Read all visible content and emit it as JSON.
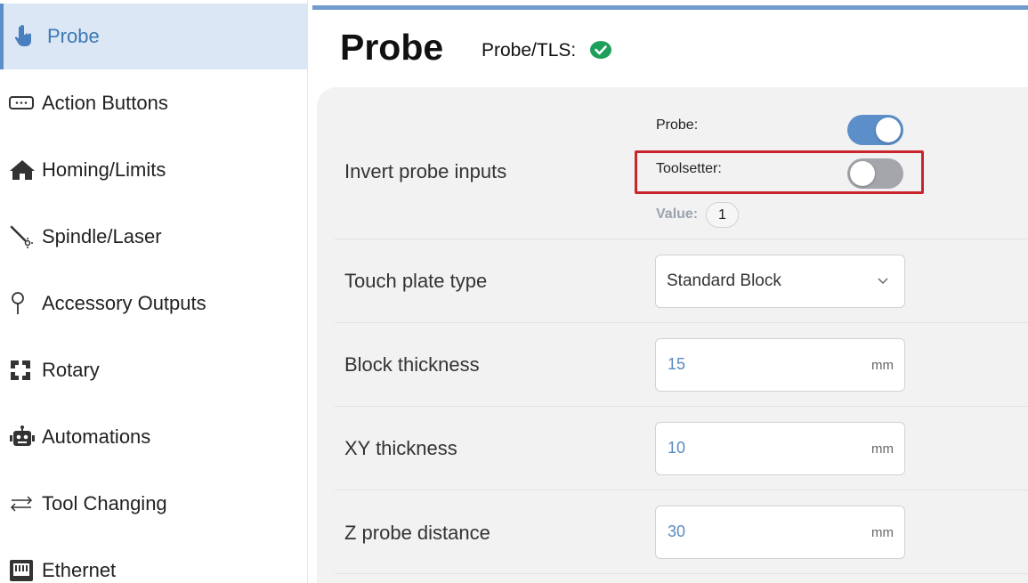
{
  "sidebar": {
    "items": [
      {
        "label": "Probe",
        "icon": "hand-pointer-icon",
        "active": true
      },
      {
        "label": "Action Buttons",
        "icon": "keyboard-icon"
      },
      {
        "label": "Homing/Limits",
        "icon": "home-icon"
      },
      {
        "label": "Spindle/Laser",
        "icon": "spindle-icon"
      },
      {
        "label": "Accessory Outputs",
        "icon": "pin-icon"
      },
      {
        "label": "Rotary",
        "icon": "rotary-icon"
      },
      {
        "label": "Automations",
        "icon": "robot-icon"
      },
      {
        "label": "Tool Changing",
        "icon": "swap-arrows-icon"
      },
      {
        "label": "Ethernet",
        "icon": "ethernet-icon"
      }
    ]
  },
  "header": {
    "title": "Probe",
    "status_label": "Probe/TLS:",
    "status_icon": "check-circle-icon",
    "status_color": "#1e9e5b"
  },
  "settings": {
    "invert": {
      "label": "Invert probe inputs",
      "probe_label": "Probe:",
      "probe_on": true,
      "toolsetter_label": "Toolsetter:",
      "toolsetter_on": false,
      "value_label": "Value:",
      "value": "1"
    },
    "touch_plate": {
      "label": "Touch plate type",
      "selected": "Standard Block"
    },
    "block_thickness": {
      "label": "Block thickness",
      "value": "15",
      "unit": "mm"
    },
    "xy_thickness": {
      "label": "XY thickness",
      "value": "10",
      "unit": "mm"
    },
    "z_probe_distance": {
      "label": "Z probe distance",
      "value": "30",
      "unit": "mm"
    }
  },
  "colors": {
    "accent": "#5c8fc9",
    "highlight": "#c8262c",
    "active_bg": "#dbe7f5"
  }
}
